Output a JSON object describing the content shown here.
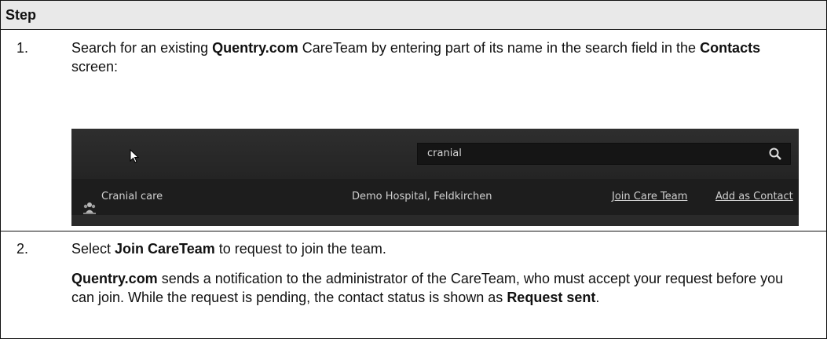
{
  "table": {
    "header": "Step",
    "rows": [
      {
        "number": "1.",
        "text_a": "Search for an existing ",
        "text_b": "Quentry.com",
        "text_c": " CareTeam by entering part of its name in the search field in the ",
        "text_d": "Contacts",
        "text_e": " screen:"
      },
      {
        "number": "2.",
        "line1_a": "Select ",
        "line1_b": "Join CareTeam",
        "line1_c": " to request to join the team.",
        "para_a": "Quentry.com",
        "para_b": " sends a notification to the administrator of the CareTeam, who must accept your request before you can join. While the request is pending, the contact status is shown as ",
        "para_c": "Request sent",
        "para_d": "."
      }
    ]
  },
  "screenshot": {
    "search": {
      "value": "cranial",
      "icon": "search-icon"
    },
    "result": {
      "icon": "careteam-icon",
      "name": "Cranial care",
      "location": "Demo Hospital, Feldkirchen",
      "join_label": "Join Care Team",
      "add_label": "Add as Contact"
    }
  }
}
